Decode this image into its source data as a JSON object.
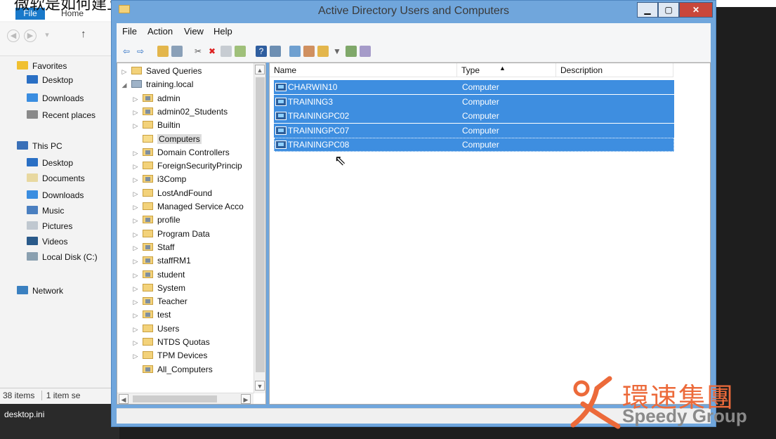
{
  "caption": "微软是如何建立电脑，是这样",
  "explorer": {
    "file_tab": "File",
    "home_tab": "Home",
    "nav": [
      {
        "label": "Favorites",
        "icon": "star-icon"
      },
      {
        "label": "Desktop",
        "icon": "desktop-icon"
      },
      {
        "label": "Downloads",
        "icon": "downloads-icon"
      },
      {
        "label": "Recent places",
        "icon": "recent-icon"
      },
      {
        "label": "This PC",
        "icon": "pc-icon"
      },
      {
        "label": "Desktop",
        "icon": "desktop-icon"
      },
      {
        "label": "Documents",
        "icon": "documents-icon"
      },
      {
        "label": "Downloads",
        "icon": "downloads-icon"
      },
      {
        "label": "Music",
        "icon": "music-icon"
      },
      {
        "label": "Pictures",
        "icon": "pictures-icon"
      },
      {
        "label": "Videos",
        "icon": "videos-icon"
      },
      {
        "label": "Local Disk (C:)",
        "icon": "disk-icon"
      },
      {
        "label": "Network",
        "icon": "network-icon"
      }
    ],
    "status_items": "38 items",
    "status_selected": "1 item se",
    "bottom_file": "desktop.ini"
  },
  "window": {
    "title": "Active Directory Users and Computers",
    "menu": [
      "File",
      "Action",
      "View",
      "Help"
    ]
  },
  "tree": {
    "rows": [
      {
        "label": "Saved Queries",
        "indent": 0,
        "arrow": "▷",
        "ou": false
      },
      {
        "label": "training.local",
        "indent": 0,
        "arrow": "◢",
        "ou": false,
        "domain": true
      },
      {
        "label": "admin",
        "indent": 1,
        "arrow": "▷",
        "ou": true
      },
      {
        "label": "admin02_Students",
        "indent": 1,
        "arrow": "▷",
        "ou": true
      },
      {
        "label": "Builtin",
        "indent": 1,
        "arrow": "▷",
        "ou": false
      },
      {
        "label": "Computers",
        "indent": 1,
        "arrow": "",
        "ou": false,
        "selected": true
      },
      {
        "label": "Domain Controllers",
        "indent": 1,
        "arrow": "▷",
        "ou": true
      },
      {
        "label": "ForeignSecurityPrincip",
        "indent": 1,
        "arrow": "▷",
        "ou": false
      },
      {
        "label": "i3Comp",
        "indent": 1,
        "arrow": "▷",
        "ou": true
      },
      {
        "label": "LostAndFound",
        "indent": 1,
        "arrow": "▷",
        "ou": false
      },
      {
        "label": "Managed Service Acco",
        "indent": 1,
        "arrow": "▷",
        "ou": false
      },
      {
        "label": "profile",
        "indent": 1,
        "arrow": "▷",
        "ou": true
      },
      {
        "label": "Program Data",
        "indent": 1,
        "arrow": "▷",
        "ou": false
      },
      {
        "label": "Staff",
        "indent": 1,
        "arrow": "▷",
        "ou": true
      },
      {
        "label": "staffRM1",
        "indent": 1,
        "arrow": "▷",
        "ou": true
      },
      {
        "label": "student",
        "indent": 1,
        "arrow": "▷",
        "ou": true
      },
      {
        "label": "System",
        "indent": 1,
        "arrow": "▷",
        "ou": false
      },
      {
        "label": "Teacher",
        "indent": 1,
        "arrow": "▷",
        "ou": true
      },
      {
        "label": "test",
        "indent": 1,
        "arrow": "▷",
        "ou": true
      },
      {
        "label": "Users",
        "indent": 1,
        "arrow": "▷",
        "ou": false
      },
      {
        "label": "NTDS Quotas",
        "indent": 1,
        "arrow": "▷",
        "ou": false
      },
      {
        "label": "TPM Devices",
        "indent": 1,
        "arrow": "▷",
        "ou": false
      },
      {
        "label": "All_Computers",
        "indent": 1,
        "arrow": "",
        "ou": true
      }
    ]
  },
  "list": {
    "columns": [
      "Name",
      "Type",
      "Description"
    ],
    "rows": [
      {
        "name": "CHARWIN10",
        "type": "Computer"
      },
      {
        "name": "TRAINING3",
        "type": "Computer"
      },
      {
        "name": "TRAININGPC02",
        "type": "Computer"
      },
      {
        "name": "TRAININGPC07",
        "type": "Computer"
      },
      {
        "name": "TRAININGPC08",
        "type": "Computer"
      }
    ]
  },
  "watermark": {
    "chinese": "環速集團",
    "english": "Speedy Group"
  },
  "colors": {
    "selection": "#3e8ee0",
    "window_frame": "#70a6dc",
    "explorer_file_tab": "#1979ca",
    "watermark_orange": "#ec6a3a"
  }
}
